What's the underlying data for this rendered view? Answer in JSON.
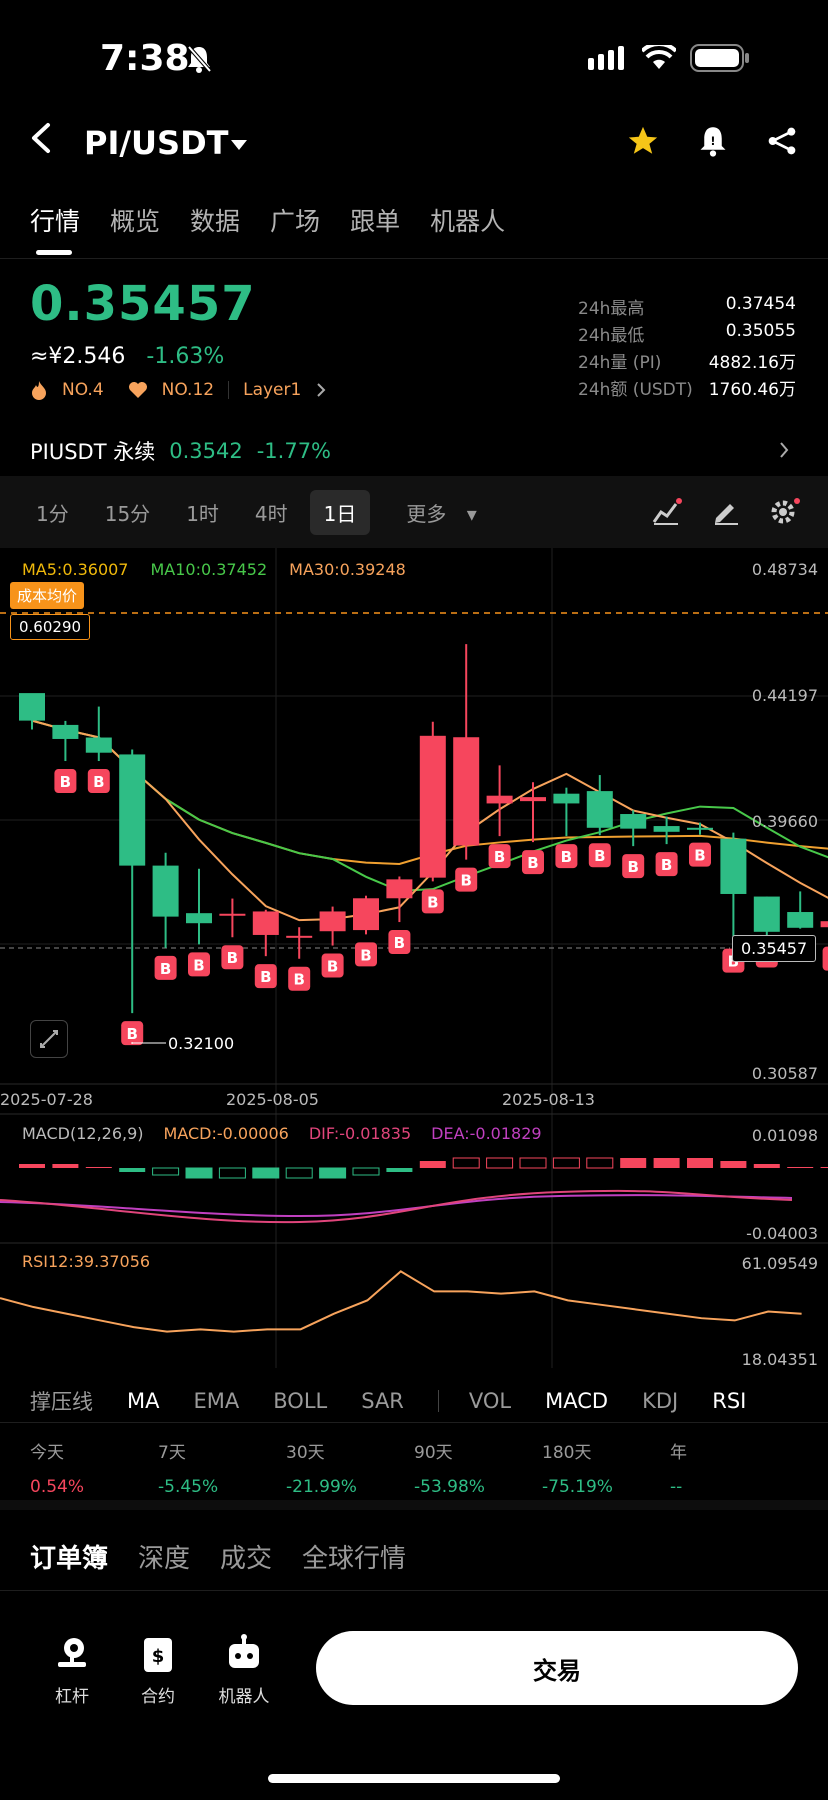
{
  "status_bar": {
    "time": "7:38"
  },
  "header": {
    "pair": "PI/USDT"
  },
  "tabs": [
    "行情",
    "概览",
    "数据",
    "广场",
    "跟单",
    "机器人"
  ],
  "ticker": {
    "price": "0.35457",
    "cny": "≈¥2.546",
    "change": "-1.63%",
    "badges": [
      "NO.4",
      "NO.12",
      "Layer1"
    ],
    "stats": [
      {
        "label": "24h最高",
        "value": "0.37454"
      },
      {
        "label": "24h最低",
        "value": "0.35055"
      },
      {
        "label": "24h量 (PI)",
        "value": "4882.16万"
      },
      {
        "label": "24h额 (USDT)",
        "value": "1760.46万"
      }
    ]
  },
  "perp": {
    "name": "PIUSDT 永续",
    "price": "0.3542",
    "change": "-1.77%"
  },
  "timeframes": [
    "1分",
    "15分",
    "1时",
    "4时",
    "1日",
    "更多"
  ],
  "chart_legend": {
    "ma5": "MA5:0.36007",
    "ma10": "MA10:0.37452",
    "ma30": "MA30:0.39248",
    "cost_tag": "成本均价",
    "cost_value": "0.60290",
    "current_price": "0.35457",
    "low_label": "0.32100",
    "yaxis": [
      "0.48734",
      "0.44197",
      "0.39660",
      "0.30587"
    ],
    "dates": [
      "2025-07-28",
      "2025-08-05",
      "2025-08-13"
    ],
    "macd": {
      "name": "MACD(12,26,9)",
      "macd": "MACD:-0.00006",
      "dif": "DIF:-0.01835",
      "dea": "DEA:-0.01829",
      "ymax": "0.01098",
      "ymin": "-0.04003"
    },
    "rsi": {
      "name": "RSI12:39.37056",
      "ymax": "61.09549",
      "ymin": "18.04351"
    }
  },
  "indicators": {
    "main": [
      "撑压线",
      "MA",
      "EMA",
      "BOLL",
      "SAR"
    ],
    "sub": [
      "VOL",
      "MACD",
      "KDJ",
      "RSI"
    ]
  },
  "performance": [
    {
      "label": "今天",
      "value": "0.54%"
    },
    {
      "label": "7天",
      "value": "-5.45%"
    },
    {
      "label": "30天",
      "value": "-21.99%"
    },
    {
      "label": "90天",
      "value": "-53.98%"
    },
    {
      "label": "180天",
      "value": "-75.19%"
    },
    {
      "label": "年",
      "value": "--"
    }
  ],
  "orderbook_tabs": [
    "订单簿",
    "深度",
    "成交",
    "全球行情"
  ],
  "bottom_nav": {
    "leverage": "杠杆",
    "contract": "合约",
    "robot": "机器人",
    "trade": "交易"
  },
  "colors": {
    "up": "#2ebd85",
    "down": "#f6465d",
    "accent": "#f7a35c"
  },
  "chart_data": {
    "type": "candlestick",
    "yrange": [
      0.30587,
      0.48734
    ],
    "candles": [
      {
        "o": 0.4367,
        "c": 0.4271,
        "h": 0.435,
        "l": 0.424
      },
      {
        "o": 0.4256,
        "c": 0.4207,
        "h": 0.427,
        "l": 0.413
      },
      {
        "o": 0.4212,
        "c": 0.4159,
        "h": 0.432,
        "l": 0.413
      },
      {
        "o": 0.4153,
        "c": 0.3765,
        "h": 0.417,
        "l": 0.325
      },
      {
        "o": 0.3765,
        "c": 0.3587,
        "h": 0.381,
        "l": 0.3478
      },
      {
        "o": 0.3599,
        "c": 0.3564,
        "h": 0.3754,
        "l": 0.349
      },
      {
        "o": 0.3594,
        "c": 0.3597,
        "h": 0.365,
        "l": 0.3515
      },
      {
        "o": 0.3523,
        "c": 0.3605,
        "h": 0.3611,
        "l": 0.3449
      },
      {
        "o": 0.3515,
        "c": 0.352,
        "h": 0.355,
        "l": 0.344
      },
      {
        "o": 0.3536,
        "c": 0.3605,
        "h": 0.3622,
        "l": 0.3486
      },
      {
        "o": 0.354,
        "c": 0.3651,
        "h": 0.366,
        "l": 0.3525
      },
      {
        "o": 0.3651,
        "c": 0.3717,
        "h": 0.3727,
        "l": 0.3568
      },
      {
        "o": 0.3723,
        "c": 0.4218,
        "h": 0.4267,
        "l": 0.371
      },
      {
        "o": 0.3835,
        "c": 0.4213,
        "h": 0.4538,
        "l": 0.3786
      },
      {
        "o": 0.3982,
        "c": 0.4009,
        "h": 0.4115,
        "l": 0.3868
      },
      {
        "o": 0.399,
        "c": 0.4004,
        "h": 0.4056,
        "l": 0.3847
      },
      {
        "o": 0.4016,
        "c": 0.3982,
        "h": 0.4037,
        "l": 0.3868
      },
      {
        "o": 0.4025,
        "c": 0.3897,
        "h": 0.4081,
        "l": 0.3871
      },
      {
        "o": 0.3945,
        "c": 0.3894,
        "h": 0.3958,
        "l": 0.3833
      },
      {
        "o": 0.3903,
        "c": 0.3883,
        "h": 0.3936,
        "l": 0.384
      },
      {
        "o": 0.3897,
        "c": 0.3893,
        "h": 0.3915,
        "l": 0.3873
      },
      {
        "o": 0.3859,
        "c": 0.3666,
        "h": 0.388,
        "l": 0.3503
      },
      {
        "o": 0.3657,
        "c": 0.3534,
        "h": 0.3657,
        "l": 0.3521
      },
      {
        "o": 0.3603,
        "c": 0.3548,
        "h": 0.3675,
        "l": 0.3545
      },
      {
        "o": 0.355,
        "c": 0.3571,
        "h": 0.3717,
        "l": 0.351
      }
    ]
  }
}
